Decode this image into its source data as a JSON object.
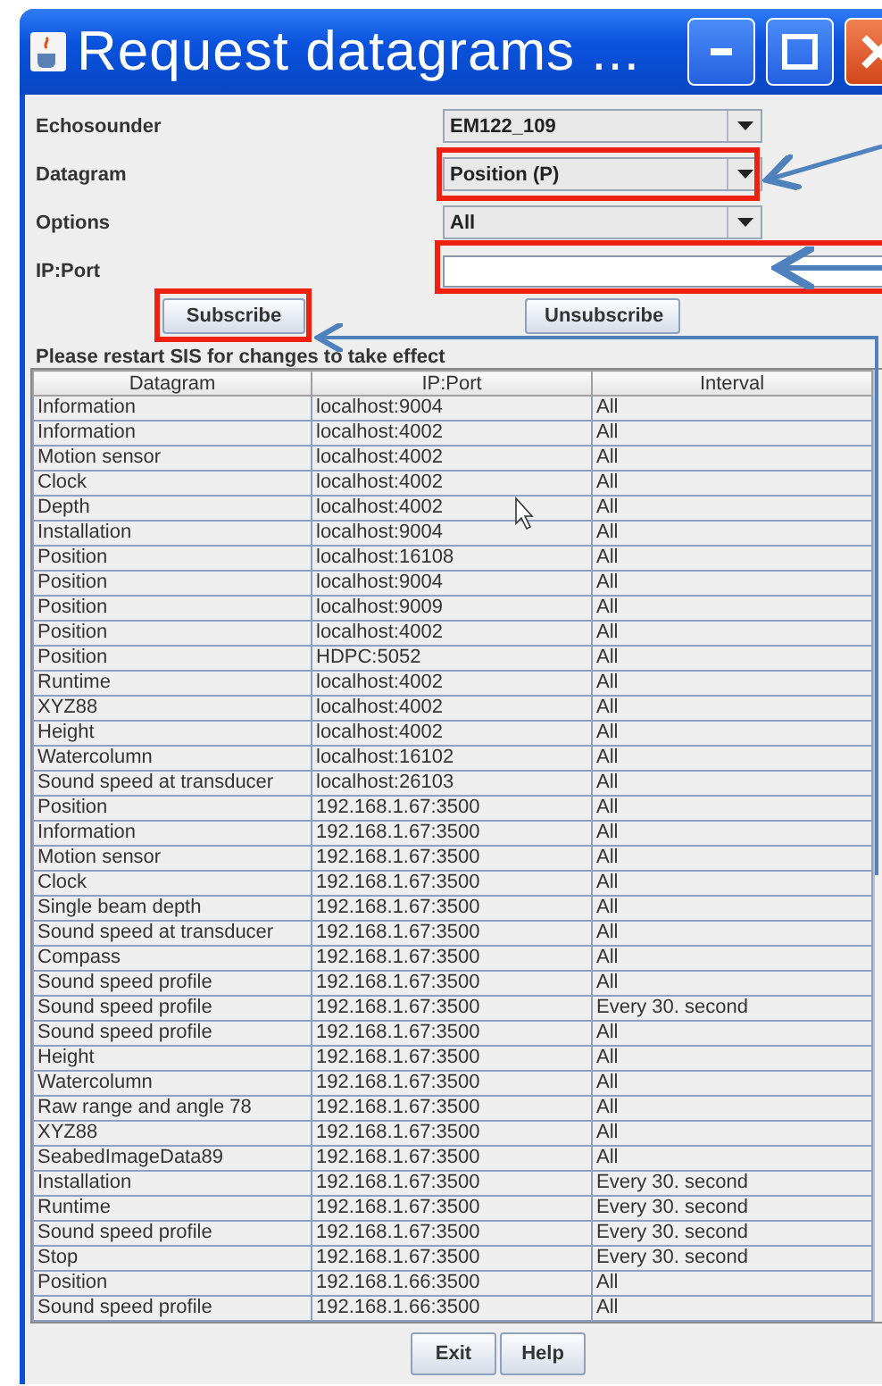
{
  "window": {
    "title": "Request datagrams ..."
  },
  "form": [
    {
      "label": "Echosounder",
      "kind": "combo",
      "value": "EM122_109"
    },
    {
      "label": "Datagram",
      "kind": "combo",
      "value": "Position (P)"
    },
    {
      "label": "Options",
      "kind": "combo",
      "value": "All"
    },
    {
      "label": "IP:Port",
      "kind": "text"
    }
  ],
  "actions": [
    "Subscribe",
    "Unsubscribe"
  ],
  "notice": "Please restart SIS for changes to take effect",
  "table": {
    "columns": [
      "Datagram",
      "IP:Port",
      "Interval"
    ],
    "rows": [
      [
        "Information",
        "localhost:9004",
        "All"
      ],
      [
        "Information",
        "localhost:4002",
        "All"
      ],
      [
        "Motion sensor",
        "localhost:4002",
        "All"
      ],
      [
        "Clock",
        "localhost:4002",
        "All"
      ],
      [
        "Depth",
        "localhost:4002",
        "All"
      ],
      [
        "Installation",
        "localhost:9004",
        "All"
      ],
      [
        "Position",
        "localhost:16108",
        "All"
      ],
      [
        "Position",
        "localhost:9004",
        "All"
      ],
      [
        "Position",
        "localhost:9009",
        "All"
      ],
      [
        "Position",
        "localhost:4002",
        "All"
      ],
      [
        "Position",
        "HDPC:5052",
        "All"
      ],
      [
        "Runtime",
        "localhost:4002",
        "All"
      ],
      [
        "XYZ88",
        "localhost:4002",
        "All"
      ],
      [
        "Height",
        "localhost:4002",
        "All"
      ],
      [
        "Watercolumn",
        "localhost:16102",
        "All"
      ],
      [
        "Sound speed at transducer",
        "localhost:26103",
        "All"
      ],
      [
        "Position",
        "192.168.1.67:3500",
        "All"
      ],
      [
        "Information",
        "192.168.1.67:3500",
        "All"
      ],
      [
        "Motion sensor",
        "192.168.1.67:3500",
        "All"
      ],
      [
        "Clock",
        "192.168.1.67:3500",
        "All"
      ],
      [
        "Single beam depth",
        "192.168.1.67:3500",
        "All"
      ],
      [
        "Sound speed at transducer",
        "192.168.1.67:3500",
        "All"
      ],
      [
        "Compass",
        "192.168.1.67:3500",
        "All"
      ],
      [
        "Sound speed profile",
        "192.168.1.67:3500",
        "All"
      ],
      [
        "Sound speed profile",
        "192.168.1.67:3500",
        "Every 30. second"
      ],
      [
        "Sound speed profile",
        "192.168.1.67:3500",
        "All"
      ],
      [
        "Height",
        "192.168.1.67:3500",
        "All"
      ],
      [
        "Watercolumn",
        "192.168.1.67:3500",
        "All"
      ],
      [
        "Raw range and angle 78",
        "192.168.1.67:3500",
        "All"
      ],
      [
        "XYZ88",
        "192.168.1.67:3500",
        "All"
      ],
      [
        "SeabedImageData89",
        "192.168.1.67:3500",
        "All"
      ],
      [
        "Installation",
        "192.168.1.67:3500",
        "Every 30. second"
      ],
      [
        "Runtime",
        "192.168.1.67:3500",
        "Every 30. second"
      ],
      [
        "Sound speed profile",
        "192.168.1.67:3500",
        "Every 30. second"
      ],
      [
        "Stop",
        "192.168.1.67:3500",
        "Every 30. second"
      ],
      [
        "Position",
        "192.168.1.66:3500",
        "All"
      ],
      [
        "Sound speed profile",
        "192.168.1.66:3500",
        "All"
      ]
    ]
  },
  "footer": [
    "Exit",
    "Help"
  ]
}
